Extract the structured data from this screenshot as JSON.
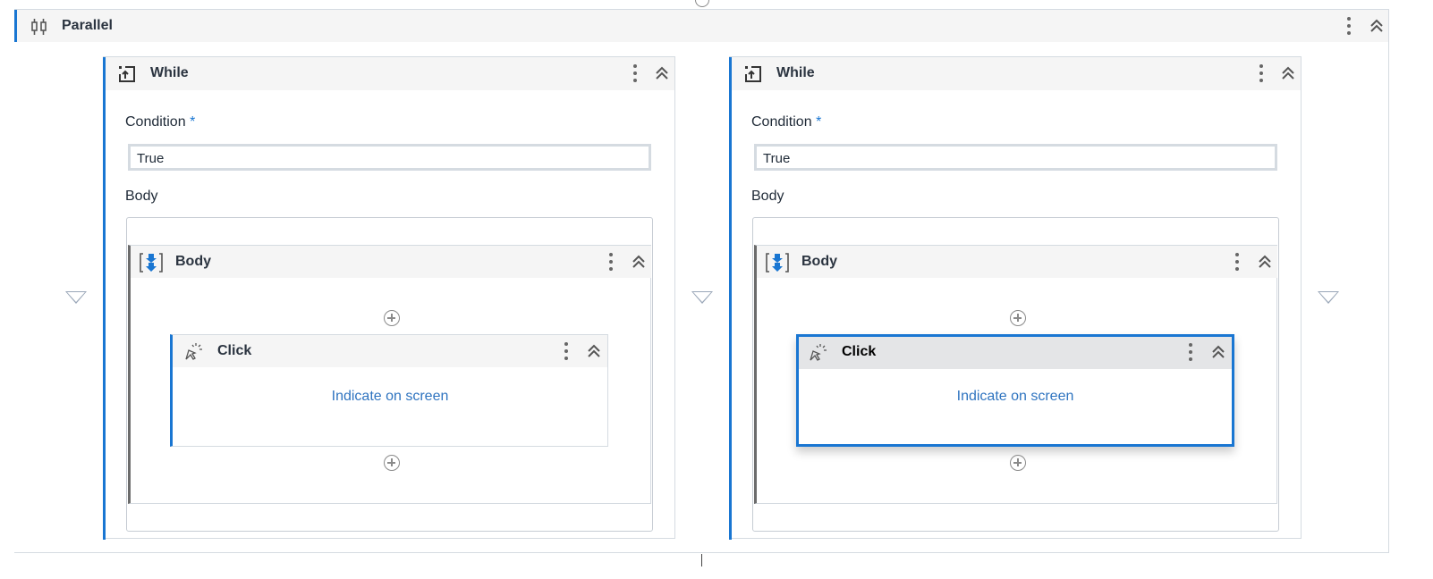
{
  "parallel": {
    "title": "Parallel",
    "icon": "parallel-icon"
  },
  "branches": [
    {
      "title": "While",
      "condition_label": "Condition",
      "required_mark": "*",
      "condition_value": "True",
      "body_label": "Body",
      "sequence_title": "Body",
      "activity_title": "Click",
      "activity_link": "Indicate on screen",
      "selected": false
    },
    {
      "title": "While",
      "condition_label": "Condition",
      "required_mark": "*",
      "condition_value": "True",
      "body_label": "Body",
      "sequence_title": "Body",
      "activity_title": "Click",
      "activity_link": "Indicate on screen",
      "selected": true
    }
  ],
  "colors": {
    "accent": "#1976d2",
    "link": "#2f74c0",
    "border": "#d5dbe1"
  }
}
